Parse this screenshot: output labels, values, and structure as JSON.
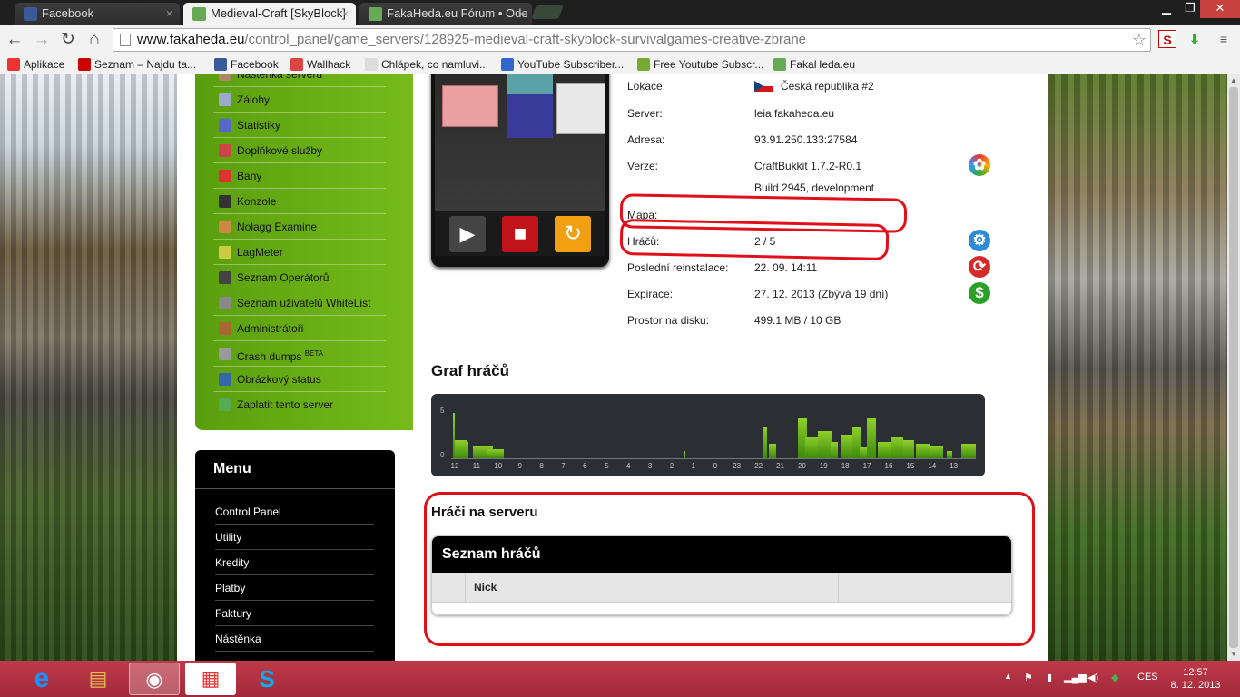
{
  "browser": {
    "tabs": [
      {
        "title": "Facebook",
        "active": false,
        "icon_color": "#3b5998"
      },
      {
        "title": "Medieval-Craft [SkyBlock]",
        "active": true,
        "icon_color": "#6a5"
      },
      {
        "title": "FakaHeda.eu Fórum • Ode",
        "active": false,
        "icon_color": "#6a5"
      }
    ],
    "close_glyph": "×",
    "window_controls": {
      "minimize": "▁",
      "maximize": "❐",
      "close": "✕"
    },
    "nav": {
      "back": "←",
      "forward": "→",
      "reload": "↻",
      "home": "⌂"
    },
    "url_domain": "www.fakaheda.eu",
    "url_path": "/control_panel/game_servers/128925-medieval-craft-skyblock-survivalgames-creative-zbrane",
    "star": "☆",
    "bookmarks": [
      {
        "label": "Aplikace",
        "color": "#e33"
      },
      {
        "label": "Seznam – Najdu ta...",
        "color": "#c00"
      },
      {
        "label": "Facebook",
        "color": "#3b5998"
      },
      {
        "label": "Wallhack",
        "color": "#d44"
      },
      {
        "label": "Chlápek, co namluvi...",
        "color": "#ddd"
      },
      {
        "label": "YouTube Subscriber...",
        "color": "#36c"
      },
      {
        "label": "Free Youtube Subscr...",
        "color": "#7a3"
      },
      {
        "label": "FakaHeda.eu",
        "color": "#6a5"
      }
    ]
  },
  "sidebar": {
    "items": [
      {
        "label": "Nástěnka serveru",
        "icon": "board-icon",
        "color": "#a86"
      },
      {
        "label": "Zálohy",
        "icon": "disc-icon",
        "color": "#9ac"
      },
      {
        "label": "Statistiky",
        "icon": "chart-icon",
        "color": "#56c"
      },
      {
        "label": "Doplňkové služby",
        "icon": "gift-icon",
        "color": "#c44"
      },
      {
        "label": "Bany",
        "icon": "ban-icon",
        "color": "#d33"
      },
      {
        "label": "Konzole",
        "icon": "console-icon",
        "color": "#333"
      },
      {
        "label": "Nolagg Examine",
        "icon": "graph-icon",
        "color": "#c84"
      },
      {
        "label": "LagMeter",
        "icon": "ruler-icon",
        "color": "#cc4"
      },
      {
        "label": "Seznam Operátorů",
        "icon": "operator-icon",
        "color": "#444"
      },
      {
        "label": "Seznam uživatelů WhiteList",
        "icon": "list-icon",
        "color": "#888"
      },
      {
        "label": "Administrátoři",
        "icon": "admin-icon",
        "color": "#a63"
      },
      {
        "label": "Crash dumps",
        "badge": "BETA",
        "icon": "gear-icon",
        "color": "#999"
      },
      {
        "label": "Obrázkový status",
        "icon": "image-icon",
        "color": "#36a"
      },
      {
        "label": "Zaplatit tento server",
        "icon": "pay-icon",
        "color": "#5a5"
      }
    ],
    "menu": {
      "title": "Menu",
      "items": [
        "Control Panel",
        "Utility",
        "Kredity",
        "Platby",
        "Faktury",
        "Nástěnka"
      ]
    }
  },
  "server": {
    "controls": {
      "play": "▶",
      "stop": "■",
      "restart": "↻"
    },
    "info": [
      {
        "label": "Lokace:",
        "value": "Česká republika #2"
      },
      {
        "label": "Server:",
        "value": "leia.fakaheda.eu"
      },
      {
        "label": "Adresa:",
        "value": "93.91.250.133:27584"
      },
      {
        "label": "Verze:",
        "value": "CraftBukkit 1.7.2-R0.1"
      },
      {
        "label": "",
        "value": "Build 2945, development"
      },
      {
        "label": "Mapa:",
        "value": ""
      },
      {
        "label": "Hráčů:",
        "value": "2 / 5"
      },
      {
        "label": "Poslední reinstalace:",
        "value": "22. 09. 14:11"
      },
      {
        "label": "Expirace:",
        "value": "27. 12. 2013 (Zbývá 19 dní)"
      },
      {
        "label": "Prostor na disku:",
        "value": "499.1 MB / 10 GB"
      }
    ],
    "action_icons": {
      "version": "✿",
      "settings": "⚙",
      "reinstall": "⟳",
      "expiry": "$"
    }
  },
  "graph": {
    "title": "Graf hráčů",
    "chart_data": {
      "type": "bar",
      "ylim": [
        0,
        5
      ],
      "ytick_labels": [
        "5",
        "0"
      ],
      "xtick_labels": [
        "12",
        "11",
        "10",
        "9",
        "8",
        "7",
        "6",
        "5",
        "4",
        "3",
        "2",
        "1",
        "0",
        "23",
        "22",
        "21",
        "20",
        "19",
        "18",
        "17",
        "16",
        "15",
        "14",
        "13"
      ]
    }
  },
  "players": {
    "title": "Hráči na serveru",
    "table_title": "Seznam hráčů",
    "columns": [
      "",
      "Nick",
      ""
    ]
  },
  "taskbar": {
    "apps": [
      {
        "name": "ie",
        "glyph": "e",
        "color": "#1e90ff"
      },
      {
        "name": "explorer",
        "glyph": "▤",
        "color": "#e8c050"
      },
      {
        "name": "chrome",
        "glyph": "◉",
        "color": "#fff"
      },
      {
        "name": "apps",
        "glyph": "▦",
        "color": "#e33"
      },
      {
        "name": "skype",
        "glyph": "S",
        "color": "#00aff0"
      }
    ],
    "tray": {
      "up": "▲",
      "flag": "⚑",
      "battery": "▮",
      "signal": "▂▄▆",
      "volume": "◀)",
      "drive": "◆"
    },
    "lang": "CES",
    "time": "12:57",
    "date": "8. 12. 2013"
  }
}
